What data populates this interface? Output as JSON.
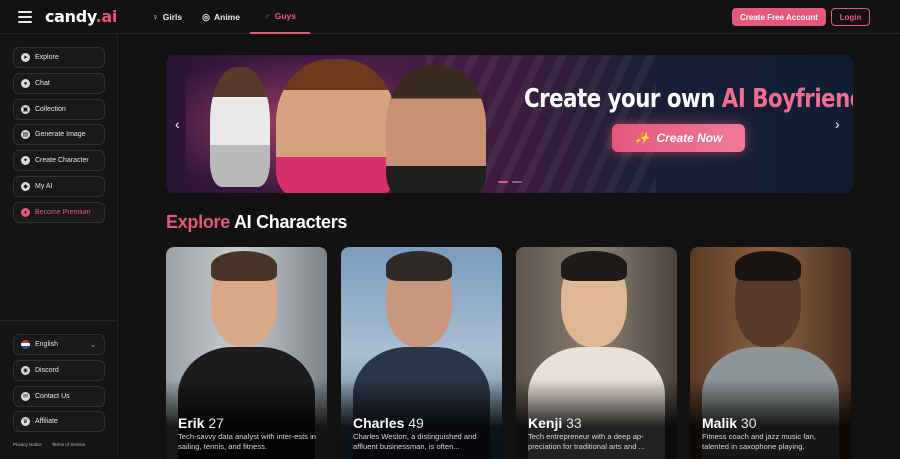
{
  "header": {
    "logo_main": "candy",
    "logo_tld": ".ai",
    "tabs": [
      {
        "icon": "♀",
        "label": "Girls"
      },
      {
        "icon": "◎",
        "label": "Anime"
      },
      {
        "icon": "♂",
        "label": "Guys"
      }
    ],
    "create_account_label": "Create Free Account",
    "login_label": "Login",
    "accent_color": "#e5587b"
  },
  "sidebar": {
    "items": [
      {
        "icon": "compass-icon",
        "label": "Explore"
      },
      {
        "icon": "chat-icon",
        "label": "Chat"
      },
      {
        "icon": "collection-icon",
        "label": "Collection"
      },
      {
        "icon": "image-icon",
        "label": "Generate Image"
      },
      {
        "icon": "sparkle-icon",
        "label": "Create Character"
      },
      {
        "icon": "mask-icon",
        "label": "My AI"
      },
      {
        "icon": "diamond-icon",
        "label": "Become Premium"
      }
    ],
    "language_label": "English",
    "bottom_items": [
      {
        "icon": "discord-icon",
        "label": "Discord"
      },
      {
        "icon": "mail-icon",
        "label": "Contact Us"
      },
      {
        "icon": "trophy-icon",
        "label": "Affiliate"
      }
    ],
    "footer_links": [
      "Privacy Notice",
      "Terms of Service"
    ]
  },
  "banner": {
    "headline_plain": "Create your own ",
    "headline_accent": "AI Boyfriend",
    "cta_label": "Create Now"
  },
  "section": {
    "title_accent": "Explore",
    "title_rest": " AI Characters"
  },
  "cards": [
    {
      "name": "Erik",
      "age": "27",
      "desc": "Tech-savvy data analyst with inter-ests in sailing, tennis, and fitness."
    },
    {
      "name": "Charles",
      "age": "49",
      "desc": "Charles Weston, a distinguished and affluent businessman, is often..."
    },
    {
      "name": "Kenji",
      "age": "33",
      "desc": "Tech entrepreneur with a deep ap-preciation for traditional arts and ..."
    },
    {
      "name": "Malik",
      "age": "30",
      "desc": "Fitness coach and jazz music fan, talented in saxophone playing."
    }
  ]
}
